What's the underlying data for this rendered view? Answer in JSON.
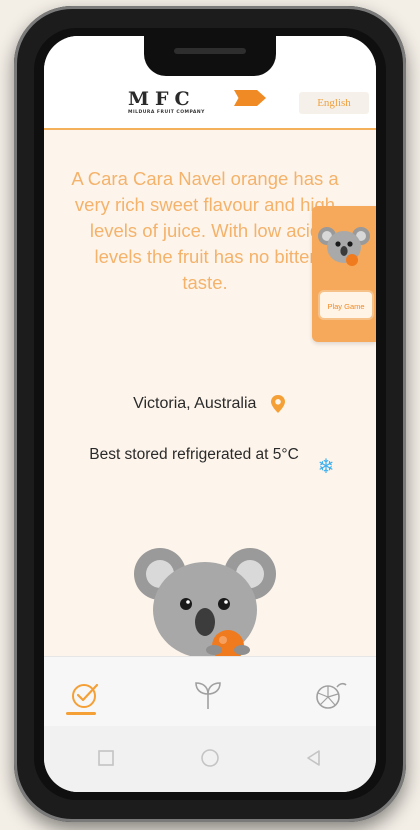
{
  "header": {
    "logo_text": "MFC",
    "logo_subtitle": "MILDURA FRUIT COMPANY",
    "language_label": "English"
  },
  "fruit": {
    "description": "A Cara Cara Navel orange has a very rich sweet flavour and high levels of juice. With low acid levels the fruit has no bitter taste.",
    "location": "Victoria, Australia",
    "storage": "Best stored refrigerated at 5°C"
  },
  "game": {
    "play_label": "Play Game"
  },
  "icons": {
    "location": "map-pin-icon",
    "storage": "snowflake-icon",
    "tabs": [
      "check-circle-icon",
      "sprout-icon",
      "orange-slice-icon"
    ],
    "system_nav": [
      "square-icon",
      "circle-icon",
      "back-triangle-icon"
    ]
  },
  "colors": {
    "accent": "#f4a037",
    "text_orange": "#f4b26a",
    "panel_orange": "#f6a95a",
    "background": "#fdf5ec",
    "snow_blue": "#3fb0ee"
  }
}
